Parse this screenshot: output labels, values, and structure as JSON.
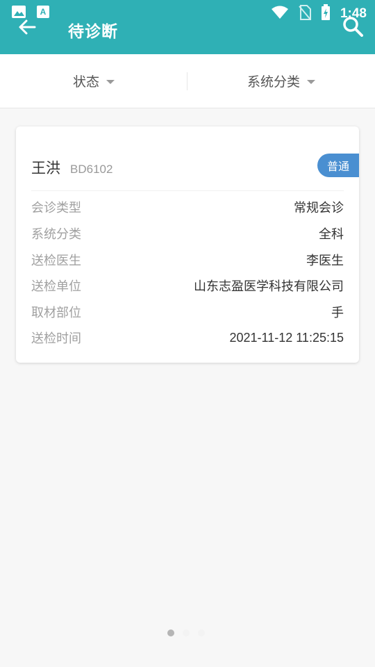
{
  "status_bar": {
    "time": "1:48",
    "icons": [
      "image-icon",
      "text-a-icon",
      "wifi-icon",
      "no-sim-icon",
      "battery-charging-icon"
    ]
  },
  "toolbar": {
    "title": "待诊断",
    "back_icon": "arrow-left-icon",
    "search_icon": "search-icon"
  },
  "filters": [
    {
      "label": "状态"
    },
    {
      "label": "系统分类"
    }
  ],
  "card": {
    "name": "王洪",
    "code": "BD6102",
    "badge": "普通",
    "rows": [
      {
        "label": "会诊类型",
        "value": "常规会诊"
      },
      {
        "label": "系统分类",
        "value": "全科"
      },
      {
        "label": "送检医生",
        "value": "李医生"
      },
      {
        "label": "送检单位",
        "value": "山东志盈医学科技有限公司"
      },
      {
        "label": "取材部位",
        "value": "手"
      },
      {
        "label": "送检时间",
        "value": "2021-11-12 11:25:15"
      }
    ]
  },
  "colors": {
    "header": "#2fb0b5",
    "badge": "#4a8fd1"
  }
}
